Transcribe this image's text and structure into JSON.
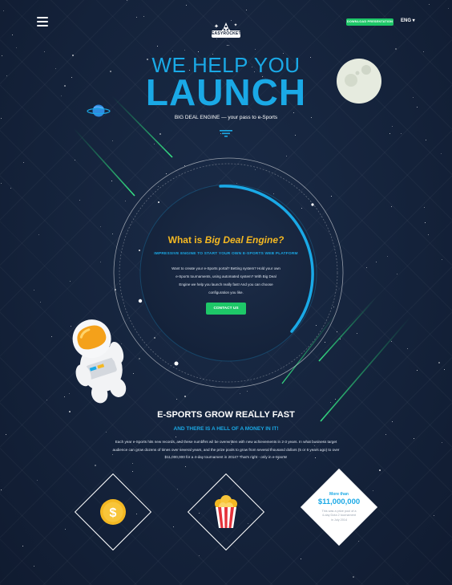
{
  "header": {
    "logo_text": "EASYROCKET",
    "download_button": "DOWNLOAD PRESENTATION",
    "language": "ENG ▾"
  },
  "hero": {
    "line1": "WE HELP YOU",
    "line2": "LAUNCH",
    "subtitle": "BIG DEAL ENGINE — your pass to e-Sports"
  },
  "about": {
    "title_prefix": "What is ",
    "title_emphasis": "Big Deal Engine?",
    "subtitle": "IMPRESSIVE ENGINE TO START YOUR OWN E-SPORTS WEB PLATFORM",
    "body": "Want to create your e-Sports portal? Betting system? Hold your own e-Sports tournaments, using automated system? With Big Deal Engine we help you launch really fast! And you can choose configuration you like.",
    "contact_button": "CONTACT US"
  },
  "esports": {
    "title": "E-SPORTS GROW REALLY FAST",
    "subtitle": "AND THERE IS A HELL OF A MONEY IN IT!",
    "body": "Each year e-Sports hits new records, and these numbers wil be overwritten with new achievements in 2-3 years. In what business target audience can grow dozens of times over several years, and the prize pools to grow from several thousand dollars (5 or 6 years ago) to over $11,000,000 for a 4-day tournament in 2014? That's right - only in e-Sports!"
  },
  "stats": {
    "label": "More than",
    "value": "$11,000,000",
    "note": "This was a prize pool of a 4-day Dota 2 tournament in July 2014"
  },
  "icons": {
    "menu": "hamburger-icon",
    "coin": "dollar-coin-icon",
    "popcorn": "popcorn-icon",
    "moon": "moon-icon",
    "planet": "planet-icon",
    "astronaut": "astronaut-icon"
  },
  "colors": {
    "background": "#14223a",
    "accent_blue": "#1aa9e6",
    "accent_green": "#1ec768",
    "accent_yellow": "#f4b822"
  }
}
